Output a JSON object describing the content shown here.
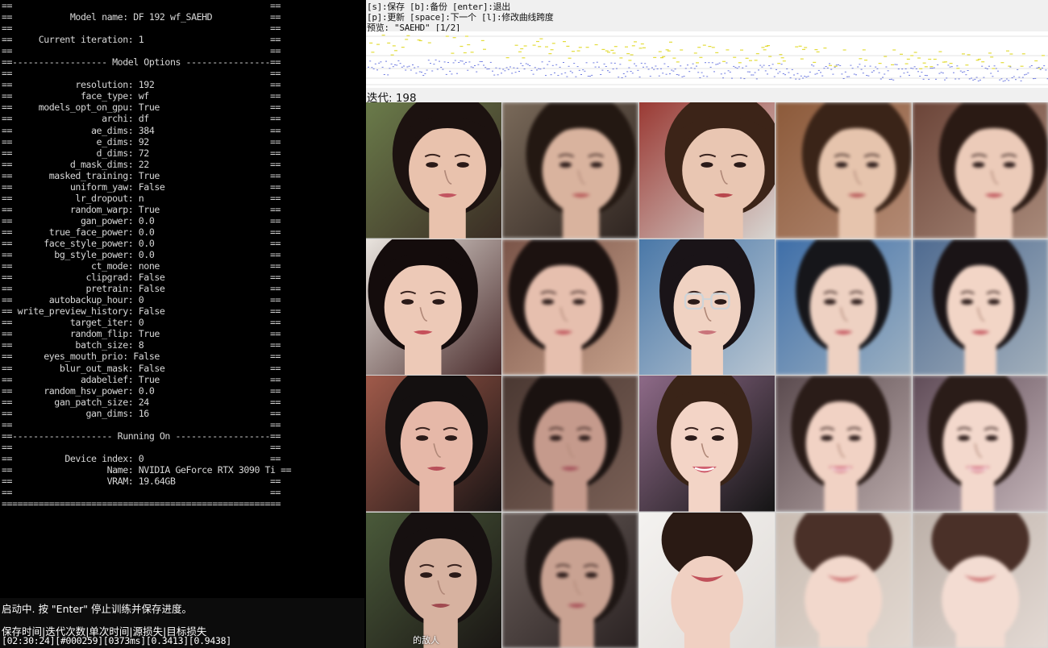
{
  "console": {
    "lines": [
      "==                                                 ==",
      "==           Model name: DF 192 wf_SAEHD           ==",
      "==                                                 ==",
      "==     Current iteration: 1                        ==",
      "==                                                 ==",
      "==------------------ Model Options ----------------==",
      "==                                                 ==",
      "==            resolution: 192                      ==",
      "==             face_type: wf                       ==",
      "==     models_opt_on_gpu: True                     ==",
      "==                 archi: df                       ==",
      "==               ae_dims: 384                      ==",
      "==                e_dims: 92                       ==",
      "==                d_dims: 72                       ==",
      "==           d_mask_dims: 22                       ==",
      "==       masked_training: True                     ==",
      "==           uniform_yaw: False                    ==",
      "==            lr_dropout: n                        ==",
      "==           random_warp: True                     ==",
      "==             gan_power: 0.0                      ==",
      "==       true_face_power: 0.0                      ==",
      "==      face_style_power: 0.0                      ==",
      "==        bg_style_power: 0.0                      ==",
      "==               ct_mode: none                     ==",
      "==              clipgrad: False                    ==",
      "==              pretrain: False                    ==",
      "==       autobackup_hour: 0                        ==",
      "== write_preview_history: False                    ==",
      "==           target_iter: 0                        ==",
      "==           random_flip: True                     ==",
      "==            batch_size: 8                        ==",
      "==      eyes_mouth_prio: False                     ==",
      "==         blur_out_mask: False                    ==",
      "==             adabelief: True                     ==",
      "==      random_hsv_power: 0.0                      ==",
      "==        gan_patch_size: 24                       ==",
      "==              gan_dims: 16                       ==",
      "==                                                 ==",
      "==------------------- Running On ------------------==",
      "==                                                 ==",
      "==          Device index: 0                        ==",
      "==                  Name: NVIDIA GeForce RTX 3090 Ti ==",
      "==                  VRAM: 19.64GB                  ==",
      "==                                                 ==",
      "====================================================="
    ],
    "status_line": "启动中. 按 \"Enter\" 停止训练并保存进度。",
    "columns_line": "保存时间|迭代次数|单次时间|源损失|目标损失",
    "values_line": "[02:30:24][#000259][0373ms][0.3413][0.9438]"
  },
  "preview": {
    "hint_line1": "[s]:保存 [b]:备份 [enter]:退出",
    "hint_line2": "[p]:更新 [space]:下一个 [l]:修改曲线跨度",
    "hint_line3": "预览: \"SAEHD\" [1/2]",
    "iteration_label": "迭代: 198",
    "caption": "的敌人",
    "colors": {
      "graph_yellow": "#e3dc3b",
      "graph_blue": "#3d4fd6",
      "console_text": "#d8d8d8"
    }
  }
}
